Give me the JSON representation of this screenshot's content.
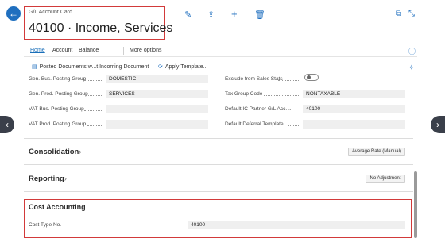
{
  "header": {
    "caption": "G/L Account Card",
    "title": "40100 · Income, Services"
  },
  "toolbar_icons": [
    "edit-icon",
    "share-icon",
    "add-icon",
    "delete-icon"
  ],
  "window_icons": [
    "open-new-icon",
    "collapse-icon"
  ],
  "tabs": [
    {
      "label": "Home"
    },
    {
      "label": "Account"
    },
    {
      "label": "Balance"
    },
    {
      "label": "More options"
    }
  ],
  "actions": [
    {
      "label": "Posted Documents w...t Incoming Document"
    },
    {
      "label": "Apply Template..."
    }
  ],
  "fields_left": [
    {
      "label": "Gen. Bus. Posting Group",
      "value": "DOMESTIC"
    },
    {
      "label": "Gen. Prod. Posting Group",
      "value": "SERVICES"
    },
    {
      "label": "VAT Bus. Posting Group",
      "value": ""
    },
    {
      "label": "VAT Prod. Posting Group",
      "value": ""
    }
  ],
  "fields_right": [
    {
      "label": "Exclude from Sales Stats",
      "value": ""
    },
    {
      "label": "Tax Group Code",
      "value": "NONTAXABLE"
    },
    {
      "label": "Default IC Partner G/L Acc. ...",
      "value": "40100"
    },
    {
      "label": "Default Deferral Template",
      "value": ""
    }
  ],
  "sections": {
    "consolidation": {
      "title": "Consolidation",
      "chevron": "›",
      "badge": "Average Rate (Manual)"
    },
    "reporting": {
      "title": "Reporting",
      "chevron": "›",
      "badge": "No Adjustment"
    },
    "cost_accounting": {
      "title": "Cost Accounting",
      "field_label": "Cost Type No.",
      "field_value": "40100"
    }
  },
  "colors": {
    "accent": "#1f6fbf",
    "highlight": "#d23a3a"
  }
}
